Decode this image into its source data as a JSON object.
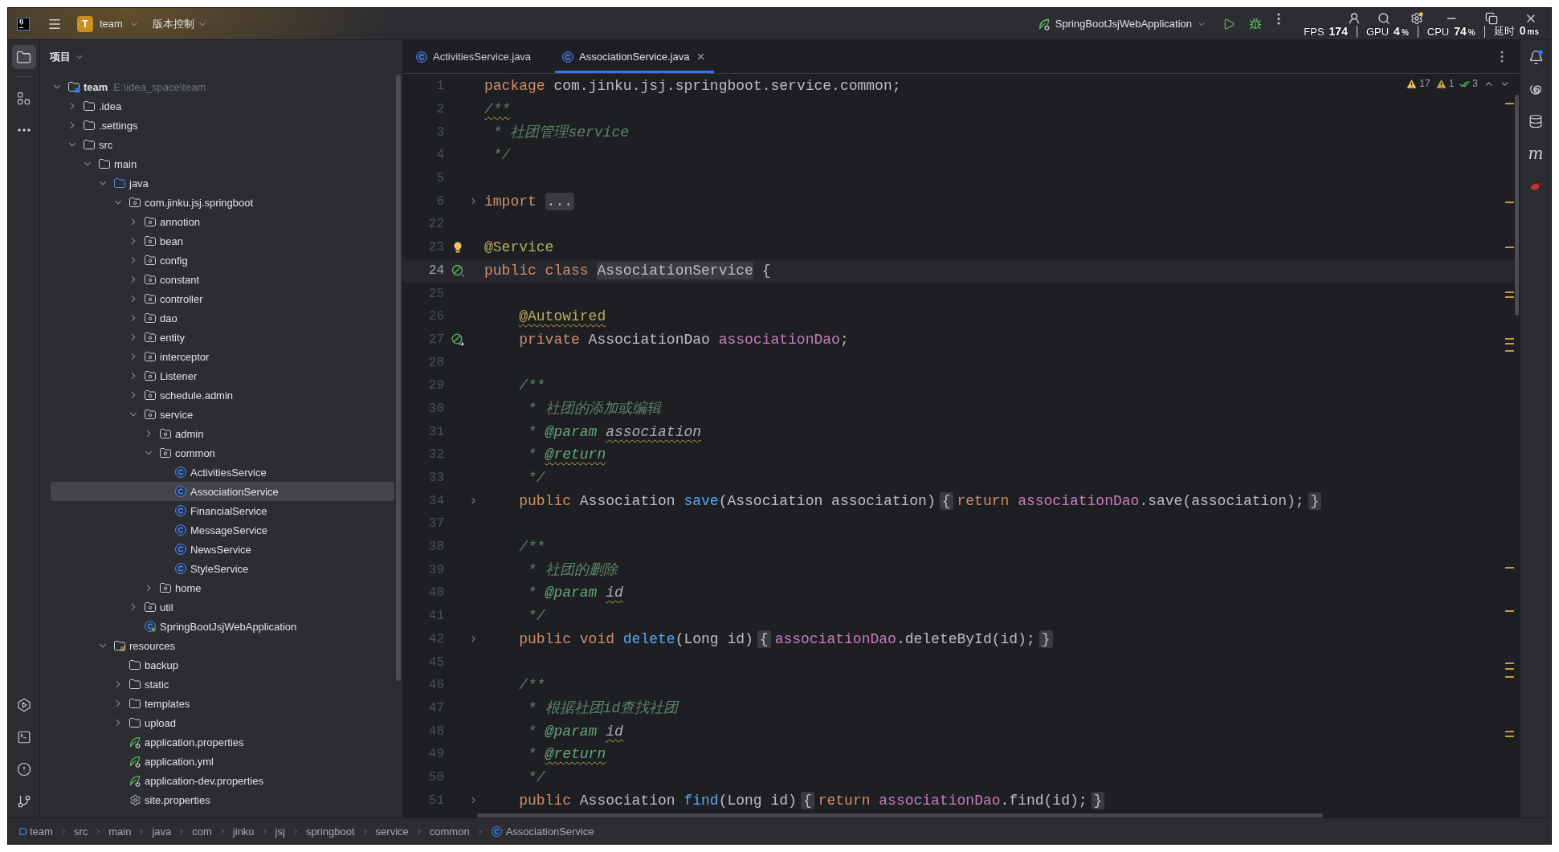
{
  "title_bar": {
    "logo": "IJ",
    "project": {
      "badge": "T",
      "name": "team"
    },
    "vcs": "版本控制",
    "run_configuration": "SpringBootJsjWebApplication"
  },
  "perf_overlay": [
    {
      "label": "FPS",
      "value": "174"
    },
    {
      "label": "GPU",
      "value": "4",
      "unit": "%"
    },
    {
      "label": "CPU",
      "value": "74",
      "unit": "%"
    },
    {
      "label": "延时",
      "value": "0",
      "unit": "ms"
    }
  ],
  "left_toolbar": {
    "top": [
      {
        "kind": "project",
        "selected": true
      },
      {
        "kind": "structure",
        "selected": false
      },
      {
        "kind": "more",
        "selected": false
      }
    ],
    "bottom": [
      {
        "kind": "services",
        "selected": false
      },
      {
        "kind": "terminal",
        "selected": false
      },
      {
        "kind": "problems",
        "selected": false
      },
      {
        "kind": "git",
        "selected": false
      }
    ]
  },
  "project_panel": {
    "title": "项目",
    "tree": [
      {
        "label": "team",
        "path": "E:\\idea_space\\team",
        "kind": "project",
        "expanded": true,
        "selected": false,
        "children": [
          {
            "label": ".idea",
            "kind": "folder",
            "expanded": false,
            "selected": false
          },
          {
            "label": ".settings",
            "kind": "folder",
            "expanded": false,
            "selected": false
          },
          {
            "label": "src",
            "kind": "folder",
            "expanded": true,
            "selected": false,
            "children": [
              {
                "label": "main",
                "kind": "folder",
                "expanded": true,
                "selected": false,
                "children": [
                  {
                    "label": "java",
                    "kind": "source_root",
                    "expanded": true,
                    "selected": false,
                    "children": [
                      {
                        "label": "com.jinku.jsj.springboot",
                        "kind": "package",
                        "expanded": true,
                        "selected": false,
                        "children": [
                          {
                            "label": "annotion",
                            "kind": "package",
                            "expanded": false,
                            "selected": false
                          },
                          {
                            "label": "bean",
                            "kind": "package",
                            "expanded": false,
                            "selected": false
                          },
                          {
                            "label": "config",
                            "kind": "package",
                            "expanded": false,
                            "selected": false
                          },
                          {
                            "label": "constant",
                            "kind": "package",
                            "expanded": false,
                            "selected": false
                          },
                          {
                            "label": "controller",
                            "kind": "package",
                            "expanded": false,
                            "selected": false
                          },
                          {
                            "label": "dao",
                            "kind": "package",
                            "expanded": false,
                            "selected": false
                          },
                          {
                            "label": "entity",
                            "kind": "package",
                            "expanded": false,
                            "selected": false
                          },
                          {
                            "label": "interceptor",
                            "kind": "package",
                            "expanded": false,
                            "selected": false
                          },
                          {
                            "label": "Listener",
                            "kind": "package",
                            "expanded": false,
                            "selected": false
                          },
                          {
                            "label": "schedule.admin",
                            "kind": "package",
                            "expanded": false,
                            "selected": false
                          },
                          {
                            "label": "service",
                            "kind": "package",
                            "expanded": true,
                            "selected": false,
                            "children": [
                              {
                                "label": "admin",
                                "kind": "package",
                                "expanded": false,
                                "selected": false
                              },
                              {
                                "label": "common",
                                "kind": "package",
                                "expanded": true,
                                "selected": false,
                                "children": [
                                  {
                                    "label": "ActivitiesService",
                                    "kind": "class",
                                    "selected": false
                                  },
                                  {
                                    "label": "AssociationService",
                                    "kind": "class",
                                    "selected": true
                                  },
                                  {
                                    "label": "FinancialService",
                                    "kind": "class",
                                    "selected": false
                                  },
                                  {
                                    "label": "MessageService",
                                    "kind": "class",
                                    "selected": false
                                  },
                                  {
                                    "label": "NewsService",
                                    "kind": "class",
                                    "selected": false
                                  },
                                  {
                                    "label": "StyleService",
                                    "kind": "class",
                                    "selected": false
                                  }
                                ]
                              },
                              {
                                "label": "home",
                                "kind": "package",
                                "expanded": false,
                                "selected": false
                              }
                            ]
                          },
                          {
                            "label": "util",
                            "kind": "package",
                            "expanded": false,
                            "selected": false
                          },
                          {
                            "label": "SpringBootJsjWebApplication",
                            "kind": "spring_boot_class",
                            "selected": false
                          }
                        ]
                      }
                    ]
                  },
                  {
                    "label": "resources",
                    "kind": "resources_root",
                    "expanded": true,
                    "selected": false,
                    "children": [
                      {
                        "label": "backup",
                        "kind": "folder",
                        "selected": false
                      },
                      {
                        "label": "static",
                        "kind": "folder",
                        "expanded": false,
                        "selected": false
                      },
                      {
                        "label": "templates",
                        "kind": "folder",
                        "expanded": false,
                        "selected": false
                      },
                      {
                        "label": "upload",
                        "kind": "folder",
                        "expanded": false,
                        "selected": false
                      },
                      {
                        "label": "application.properties",
                        "kind": "spring_config",
                        "selected": false
                      },
                      {
                        "label": "application.yml",
                        "kind": "spring_config",
                        "selected": false
                      },
                      {
                        "label": "application-dev.properties",
                        "kind": "spring_config",
                        "selected": false
                      },
                      {
                        "label": "site.properties",
                        "kind": "settings_file",
                        "selected": false
                      }
                    ]
                  }
                ]
              }
            ]
          }
        ]
      }
    ]
  },
  "editor_tabs": [
    {
      "label": "ActivitiesService.java",
      "selected": false
    },
    {
      "label": "AssociationService.java",
      "selected": true
    }
  ],
  "inspection_widget": [
    {
      "kind": "warning",
      "count": "17"
    },
    {
      "kind": "weak_warning",
      "count": "1"
    },
    {
      "kind": "typo",
      "count": "3"
    }
  ],
  "code_lines": [
    {
      "number": "1",
      "current": false,
      "folded": false,
      "indented": false,
      "tokens": [
        {
          "kind": "keyword",
          "text": "package"
        },
        {
          "kind": "plain",
          "text": " com.jinku.jsj.springboot.service.common;"
        }
      ]
    },
    {
      "number": "2",
      "current": false,
      "folded": false,
      "indented": false,
      "tokens": [
        {
          "kind": "doc",
          "text": "/**",
          "squiggle": true
        }
      ]
    },
    {
      "number": "3",
      "current": false,
      "folded": false,
      "indented": false,
      "tokens": [
        {
          "kind": "doc",
          "text": " * 社团管理service"
        }
      ]
    },
    {
      "number": "4",
      "current": false,
      "folded": false,
      "indented": false,
      "tokens": [
        {
          "kind": "doc",
          "text": " */"
        }
      ]
    },
    {
      "number": "5",
      "current": false,
      "folded": false
    },
    {
      "number": "6",
      "current": false,
      "folded": true,
      "indented": false,
      "tokens": [
        {
          "kind": "keyword",
          "text": "import"
        },
        {
          "kind": "folded_text",
          "text": "..."
        }
      ]
    },
    {
      "number": "22",
      "current": false,
      "folded": false
    },
    {
      "number": "23",
      "current": false,
      "folded": false,
      "indented": false,
      "gutter": {
        "kind": "intention_bulb"
      },
      "tokens": [
        {
          "kind": "annotation",
          "text": "@Service"
        }
      ]
    },
    {
      "number": "24",
      "current": true,
      "folded": false,
      "indented": false,
      "gutter": {
        "kind": "bean"
      },
      "tokens": [
        {
          "kind": "keyword",
          "text": "public class "
        },
        {
          "kind": "class_decl",
          "text": "AssociationService"
        },
        {
          "kind": "plain",
          "text": " {"
        }
      ]
    },
    {
      "number": "25",
      "current": false,
      "folded": false
    },
    {
      "number": "26",
      "current": false,
      "folded": false,
      "indented": true,
      "tokens": [
        {
          "kind": "annotation",
          "text": "@Autowired",
          "squiggle": true
        }
      ]
    },
    {
      "number": "27",
      "current": false,
      "folded": false,
      "indented": true,
      "gutter": {
        "kind": "injected_bean"
      },
      "tokens": [
        {
          "kind": "keyword",
          "text": "private"
        },
        {
          "kind": "plain",
          "text": " AssociationDao "
        },
        {
          "kind": "field",
          "text": "associationDao"
        },
        {
          "kind": "plain",
          "text": ";"
        }
      ]
    },
    {
      "number": "28",
      "current": false,
      "folded": false
    },
    {
      "number": "29",
      "current": false,
      "folded": false,
      "indented": true,
      "tokens": [
        {
          "kind": "doc",
          "text": "/**"
        }
      ]
    },
    {
      "number": "30",
      "current": false,
      "folded": false,
      "indented": true,
      "tokens": [
        {
          "kind": "doc",
          "text": " * 社团的添加或编辑"
        }
      ]
    },
    {
      "number": "31",
      "current": false,
      "folded": false,
      "indented": true,
      "tokens": [
        {
          "kind": "doc",
          "text": " * "
        },
        {
          "kind": "doc_tag",
          "text": "@param "
        },
        {
          "kind": "doc_value",
          "text": "association",
          "squiggle": true
        }
      ]
    },
    {
      "number": "32",
      "current": false,
      "folded": false,
      "indented": true,
      "tokens": [
        {
          "kind": "doc",
          "text": " * "
        },
        {
          "kind": "doc_tag",
          "text": "@return",
          "squiggle": true
        }
      ]
    },
    {
      "number": "33",
      "current": false,
      "folded": false,
      "indented": true,
      "tokens": [
        {
          "kind": "doc",
          "text": " */"
        }
      ]
    },
    {
      "number": "34",
      "current": false,
      "folded": true,
      "indented": true,
      "tokens": [
        {
          "kind": "keyword",
          "text": "public"
        },
        {
          "kind": "plain",
          "text": " Association "
        },
        {
          "kind": "method",
          "text": "save"
        },
        {
          "kind": "plain",
          "text": "(Association association)"
        },
        {
          "kind": "fold_brace",
          "text": "{"
        },
        {
          "kind": "keyword",
          "text": "return "
        },
        {
          "kind": "field",
          "text": "associationDao"
        },
        {
          "kind": "plain",
          "text": ".save(association);"
        },
        {
          "kind": "fold_brace",
          "text": "}"
        }
      ]
    },
    {
      "number": "37",
      "current": false,
      "folded": false
    },
    {
      "number": "38",
      "current": false,
      "folded": false,
      "indented": true,
      "tokens": [
        {
          "kind": "doc",
          "text": "/**"
        }
      ]
    },
    {
      "number": "39",
      "current": false,
      "folded": false,
      "indented": true,
      "tokens": [
        {
          "kind": "doc",
          "text": " * 社团的删除"
        }
      ]
    },
    {
      "number": "40",
      "current": false,
      "folded": false,
      "indented": true,
      "tokens": [
        {
          "kind": "doc",
          "text": " * "
        },
        {
          "kind": "doc_tag",
          "text": "@param "
        },
        {
          "kind": "doc_value",
          "text": "id",
          "squiggle": true
        }
      ]
    },
    {
      "number": "41",
      "current": false,
      "folded": false,
      "indented": true,
      "tokens": [
        {
          "kind": "doc",
          "text": " */"
        }
      ]
    },
    {
      "number": "42",
      "current": false,
      "folded": true,
      "indented": true,
      "tokens": [
        {
          "kind": "keyword",
          "text": "public void "
        },
        {
          "kind": "method",
          "text": "delete"
        },
        {
          "kind": "plain",
          "text": "(Long id)"
        },
        {
          "kind": "fold_brace",
          "text": "{"
        },
        {
          "kind": "field",
          "text": "associationDao"
        },
        {
          "kind": "plain",
          "text": ".deleteById(id);"
        },
        {
          "kind": "fold_brace",
          "text": "}"
        }
      ]
    },
    {
      "number": "45",
      "current": false,
      "folded": false
    },
    {
      "number": "46",
      "current": false,
      "folded": false,
      "indented": true,
      "tokens": [
        {
          "kind": "doc",
          "text": "/**"
        }
      ]
    },
    {
      "number": "47",
      "current": false,
      "folded": false,
      "indented": true,
      "tokens": [
        {
          "kind": "doc",
          "text": " * 根据社团id查找社团"
        }
      ]
    },
    {
      "number": "48",
      "current": false,
      "folded": false,
      "indented": true,
      "tokens": [
        {
          "kind": "doc",
          "text": " * "
        },
        {
          "kind": "doc_tag",
          "text": "@param "
        },
        {
          "kind": "doc_value",
          "text": "id",
          "squiggle": true
        }
      ]
    },
    {
      "number": "49",
      "current": false,
      "folded": false,
      "indented": true,
      "tokens": [
        {
          "kind": "doc",
          "text": " * "
        },
        {
          "kind": "doc_tag",
          "text": "@return",
          "squiggle": true
        }
      ]
    },
    {
      "number": "50",
      "current": false,
      "folded": false,
      "indented": true,
      "tokens": [
        {
          "kind": "doc",
          "text": " */"
        }
      ]
    },
    {
      "number": "51",
      "current": false,
      "folded": true,
      "indented": true,
      "tokens": [
        {
          "kind": "keyword",
          "text": "public"
        },
        {
          "kind": "plain",
          "text": " Association "
        },
        {
          "kind": "method",
          "text": "find"
        },
        {
          "kind": "plain",
          "text": "(Long id)"
        },
        {
          "kind": "fold_brace",
          "text": "{"
        },
        {
          "kind": "keyword",
          "text": "return "
        },
        {
          "kind": "field",
          "text": "associationDao"
        },
        {
          "kind": "plain",
          "text": ".find(id);"
        },
        {
          "kind": "fold_brace",
          "text": "}"
        }
      ]
    }
  ],
  "right_toolbar": [
    {
      "kind": "notifications",
      "selected": false
    },
    {
      "kind": "ai_assistant",
      "selected": false
    },
    {
      "kind": "database",
      "selected": false
    },
    {
      "kind": "maven",
      "glyph": "m",
      "selected": false
    },
    {
      "kind": "plugin",
      "selected": false
    }
  ],
  "breadcrumbs": [
    {
      "label": "team",
      "kind": "module"
    },
    {
      "label": "src",
      "kind": "folder"
    },
    {
      "label": "main",
      "kind": "folder"
    },
    {
      "label": "java",
      "kind": "folder"
    },
    {
      "label": "com",
      "kind": "folder"
    },
    {
      "label": "jinku",
      "kind": "folder"
    },
    {
      "label": "jsj",
      "kind": "folder"
    },
    {
      "label": "springboot",
      "kind": "folder"
    },
    {
      "label": "service",
      "kind": "folder"
    },
    {
      "label": "common",
      "kind": "folder"
    },
    {
      "label": "AssociationService",
      "kind": "class"
    }
  ]
}
